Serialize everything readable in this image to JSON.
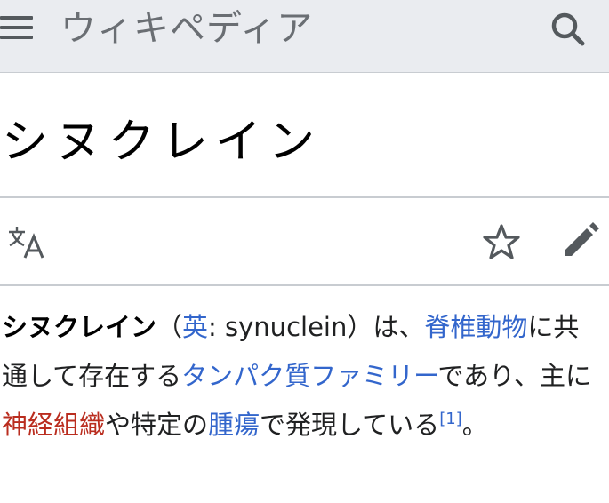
{
  "header": {
    "wordmark": "ウィキペディア",
    "menu_icon": "hamburger-menu-icon",
    "search_icon": "search-icon"
  },
  "page": {
    "title": "シヌクレイン"
  },
  "toolbar": {
    "language_icon": "language-icon",
    "watch_icon": "star-icon",
    "edit_icon": "pencil-icon"
  },
  "article": {
    "term_bold": "シヌクレイン",
    "paren_open": "（",
    "lang_link": "英",
    "lang_text": ": synuclein",
    "paren_close": "）は、",
    "link_vertebrate": "脊椎動物",
    "text_1": "に共通して存在する",
    "link_protein_family": "タンパク質ファミリー",
    "text_2": "であり、主に",
    "link_nervous_tissue": "神経組織",
    "text_3": "や特定の",
    "link_tumor": "腫瘍",
    "text_4": "で発現している",
    "ref_1": "[1]",
    "text_end": "。"
  },
  "colors": {
    "link": "#3366cc",
    "redlink": "#ba2d1f",
    "header_bg": "#eaecf0",
    "icon": "#54595d"
  }
}
